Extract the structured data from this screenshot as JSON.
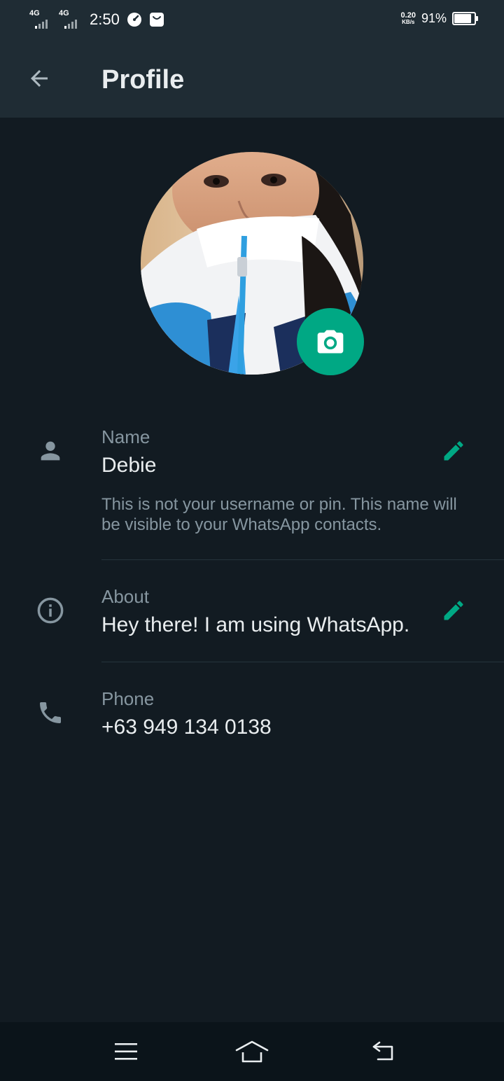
{
  "status_bar": {
    "sim1_network": "4G",
    "sim2_network": "4G",
    "time": "2:50",
    "speed_value": "0.20",
    "speed_unit": "KB/s",
    "battery_percent": "91%",
    "battery_level": 0.91,
    "icons": [
      "speedometer-icon",
      "bag-notification-icon"
    ]
  },
  "app_bar": {
    "back_icon": "arrow-left-icon",
    "title": "Profile"
  },
  "profile": {
    "avatar_icon": "camera-icon",
    "name": {
      "icon": "person-icon",
      "label": "Name",
      "value": "Debie",
      "hint": "This is not your username or pin. This name will be visible to your WhatsApp contacts.",
      "edit_icon": "pencil-icon"
    },
    "about": {
      "icon": "info-icon",
      "label": "About",
      "value": "Hey there! I am using WhatsApp.",
      "edit_icon": "pencil-icon"
    },
    "phone": {
      "icon": "phone-icon",
      "label": "Phone",
      "value": "+63 949 134 0138"
    }
  },
  "nav_bar": {
    "icons": [
      "menu-icon",
      "home-icon",
      "back-icon"
    ]
  },
  "colors": {
    "background": "#121b22",
    "header": "#1f2c34",
    "accent": "#00a884",
    "secondary_text": "#8696a0",
    "primary_text": "#e9edef"
  }
}
